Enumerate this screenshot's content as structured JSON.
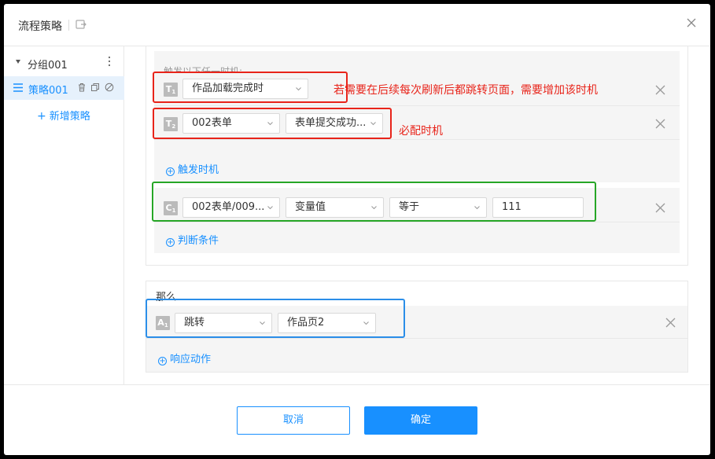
{
  "dialog": {
    "title": "流程策略"
  },
  "sidebar": {
    "group_label": "分组001",
    "strategy_label": "策略001",
    "add_label": "新增策略"
  },
  "when": {
    "heading": "触发以下任一时机:",
    "triggers": [
      {
        "badge": "T",
        "sub": "1",
        "select1": "作品加载完成时"
      },
      {
        "badge": "T",
        "sub": "2",
        "select1": "002表单",
        "select2": "表单提交成功..."
      }
    ],
    "add_trigger_label": "触发时机",
    "condition": {
      "badge": "C",
      "sub": "1",
      "select1": "002表单/009...",
      "select2": "变量值",
      "select3": "等于",
      "value": "111"
    },
    "add_condition_label": "判断条件"
  },
  "then": {
    "heading": "那么",
    "action": {
      "badge": "A",
      "sub": "1",
      "select1": "跳转",
      "select2": "作品页2"
    },
    "add_action_label": "响应动作"
  },
  "annotations": {
    "note1": "若需要在后续每次刷新后都跳转页面，需要增加该时机",
    "note2": "必配时机"
  },
  "footer": {
    "cancel_label": "取消",
    "ok_label": "确定"
  },
  "colors": {
    "accent": "#1890ff",
    "annotation_red": "#e8241a",
    "annotation_green": "#26a626",
    "annotation_blue": "#2b8ee8"
  },
  "icons": {
    "export": "export-icon",
    "close": "close-icon",
    "delete": "trash-icon",
    "copy": "copy-icon",
    "disable": "ban-icon",
    "list": "list-icon",
    "more": "kebab-icon"
  }
}
